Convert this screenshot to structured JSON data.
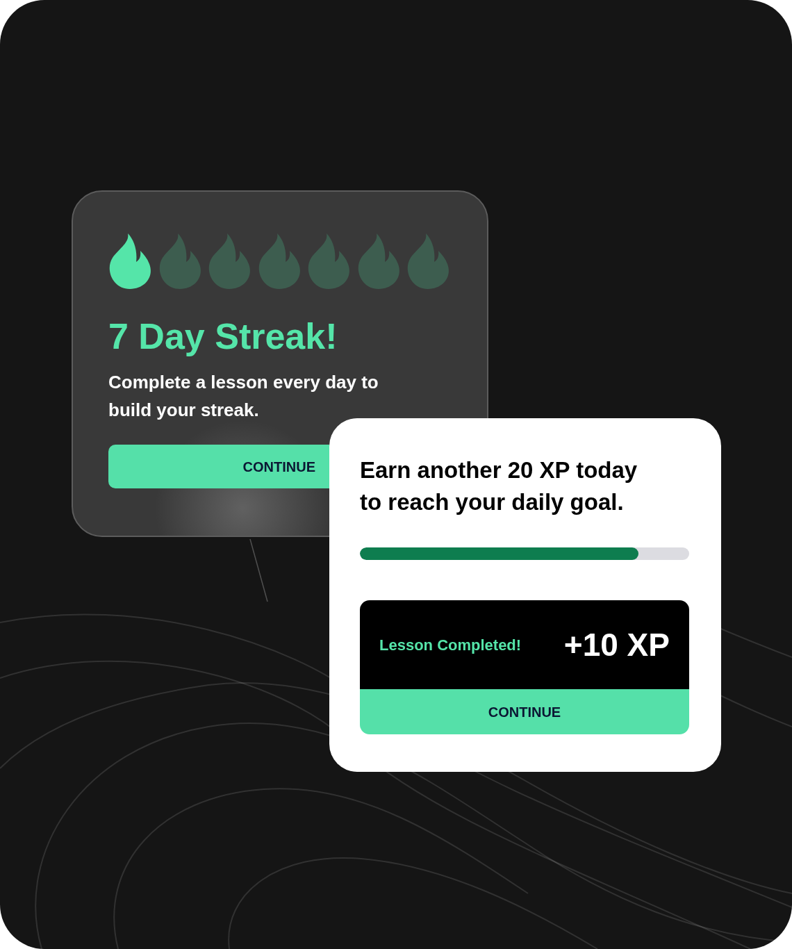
{
  "streak_card": {
    "stars": 1,
    "title": "7 Day Streak!",
    "message": "Complete a lesson every day to build your streak.",
    "button": "CONTINUE"
  },
  "goal_card": {
    "message": "Earn another 20 XP today to reach your daily goal.",
    "progress": {
      "level": 0.846
    },
    "reward": {
      "label": "Lesson Completed!",
      "xp": "+10 XP"
    },
    "button": "CONTINUE"
  }
}
